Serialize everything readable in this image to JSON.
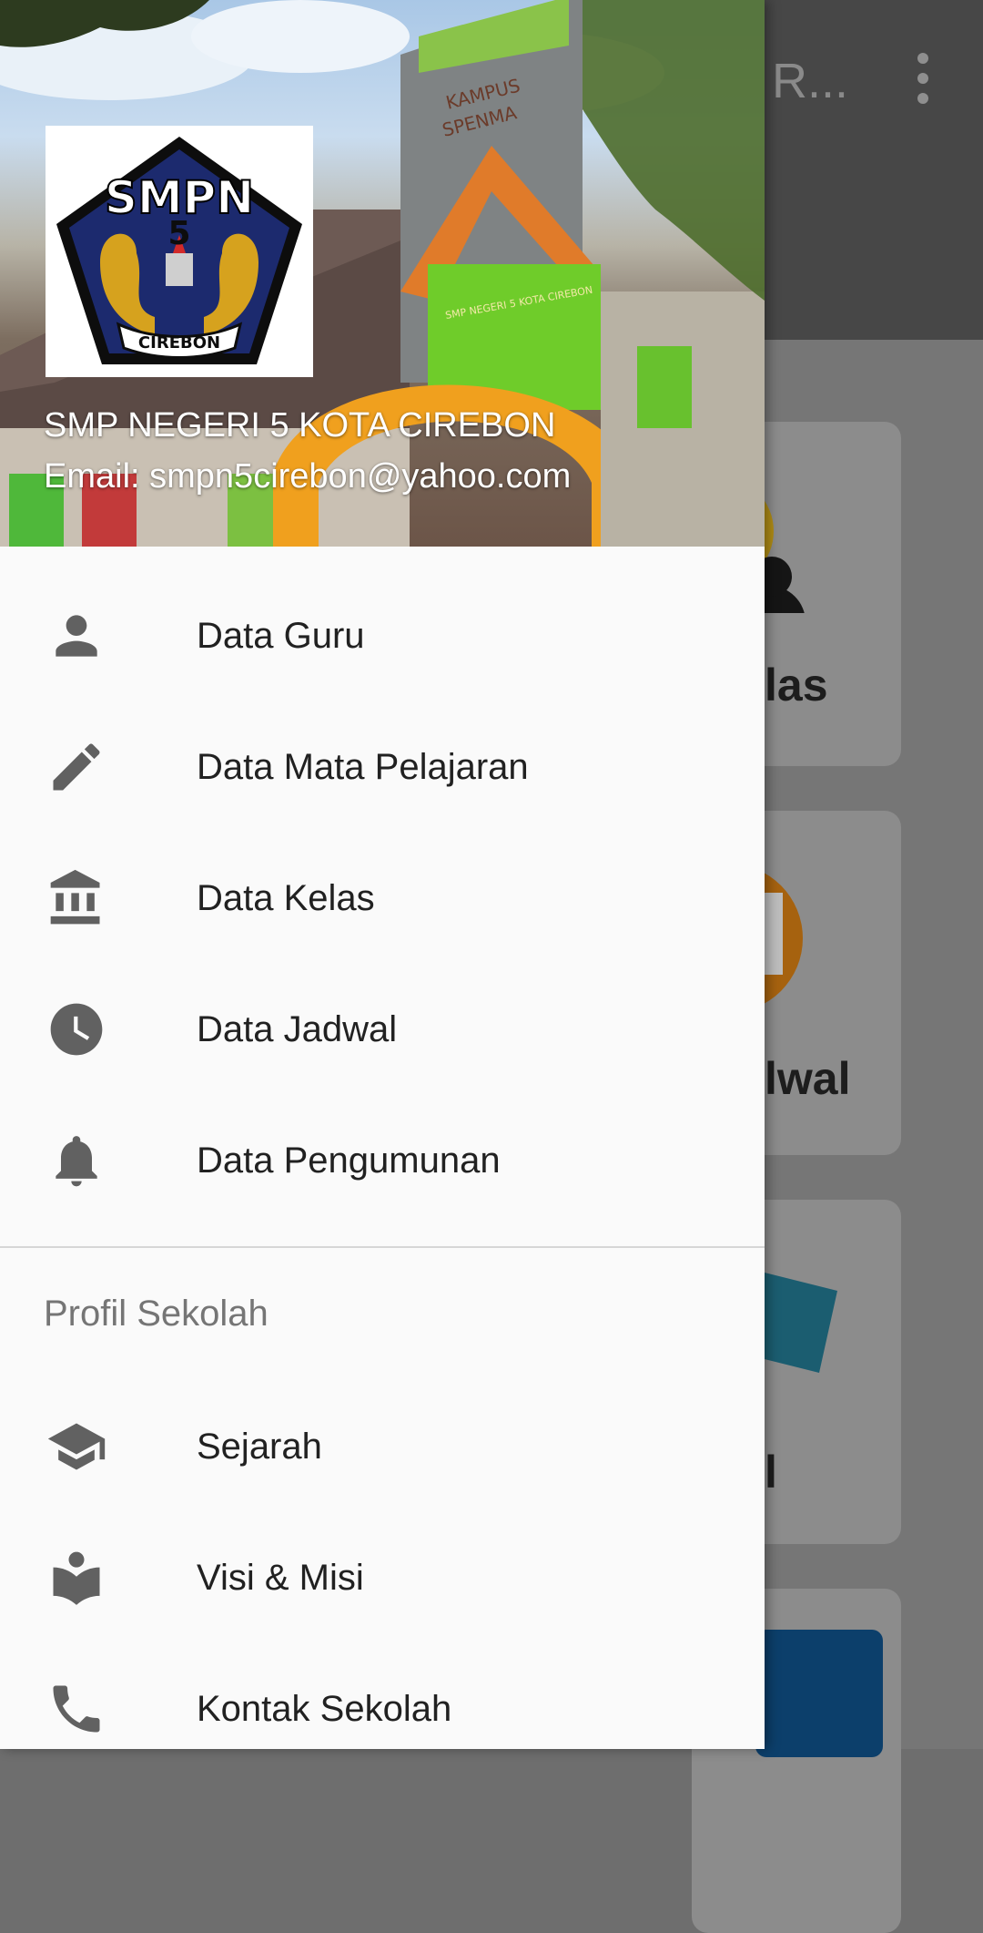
{
  "background_app": {
    "toolbar_title": "R...",
    "cards": [
      {
        "label": "las"
      },
      {
        "label": "lwal"
      },
      {
        "label": "l"
      }
    ]
  },
  "drawer": {
    "header": {
      "logo_text_top": "SMPN",
      "logo_number": "5",
      "logo_text_bottom": "CIREBON",
      "photo_text_1": "KAMPUS",
      "photo_text_2": "SPENMA",
      "photo_text_3": "SMP NEGERI 5 KOTA CIREBON",
      "school_name": "SMP NEGERI 5 KOTA CIREBON",
      "email": "Email: smpn5cirebon@yahoo.com"
    },
    "menu": [
      {
        "label": "Data Guru",
        "icon": "person-icon"
      },
      {
        "label": "Data Mata Pelajaran",
        "icon": "pencil-icon"
      },
      {
        "label": "Data Kelas",
        "icon": "bank-icon"
      },
      {
        "label": "Data Jadwal",
        "icon": "clock-icon"
      },
      {
        "label": "Data Pengumunan",
        "icon": "bell-icon"
      }
    ],
    "section_title": "Profil Sekolah",
    "section_menu": [
      {
        "label": "Sejarah",
        "icon": "school-icon"
      },
      {
        "label": "Visi & Misi",
        "icon": "book-reader-icon"
      },
      {
        "label": "Kontak Sekolah",
        "icon": "phone-icon"
      }
    ]
  },
  "colors": {
    "icon": "#616161",
    "text": "#212121",
    "section": "#757575",
    "drawer_bg": "#fafafa",
    "scrim_toolbar": "#474747"
  }
}
